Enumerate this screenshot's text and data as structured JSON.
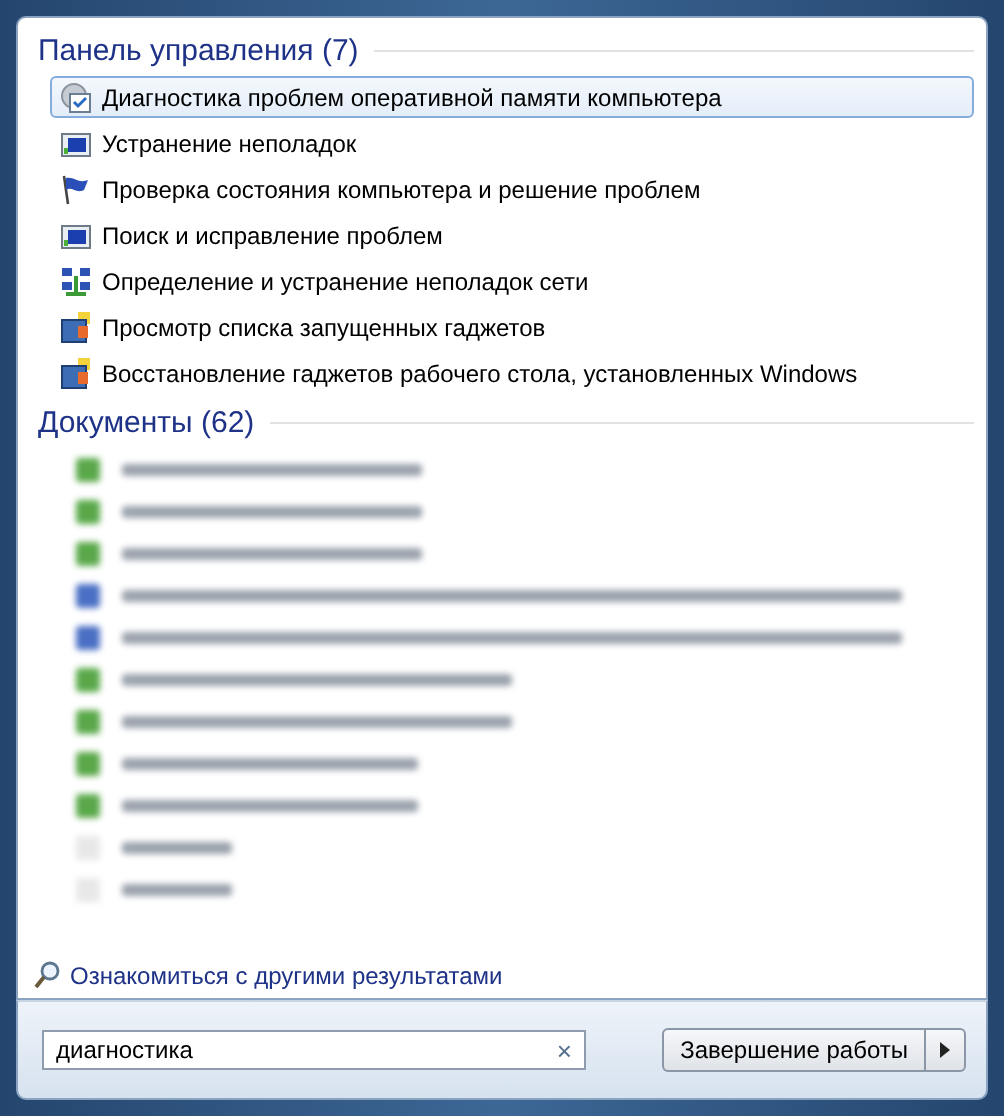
{
  "control_panel": {
    "heading": "Панель управления (7)",
    "items": [
      {
        "label": "Диагностика проблем оперативной памяти компьютера",
        "kind": "memory",
        "selected": true
      },
      {
        "label": "Устранение неполадок",
        "kind": "troubleshoot",
        "selected": false
      },
      {
        "label": "Проверка состояния компьютера и решение проблем",
        "kind": "flag",
        "selected": false
      },
      {
        "label": "Поиск и исправление проблем",
        "kind": "troubleshoot",
        "selected": false
      },
      {
        "label": "Определение и устранение неполадок сети",
        "kind": "network",
        "selected": false
      },
      {
        "label": "Просмотр списка запущенных гаджетов",
        "kind": "gadget",
        "selected": false
      },
      {
        "label": "Восстановление гаджетов рабочего стола, установленных Windows",
        "kind": "gadget",
        "selected": false
      }
    ]
  },
  "documents": {
    "heading": "Документы (62)",
    "items": [
      {
        "kind": "sheet"
      },
      {
        "kind": "sheet"
      },
      {
        "kind": "sheet"
      },
      {
        "kind": "doc"
      },
      {
        "kind": "doc"
      },
      {
        "kind": "sheet"
      },
      {
        "kind": "sheet"
      },
      {
        "kind": "sheet"
      },
      {
        "kind": "sheet"
      },
      {
        "kind": "blank"
      },
      {
        "kind": "blank"
      }
    ]
  },
  "more_results": "Ознакомиться с другими результатами",
  "search": {
    "value": "диагностика",
    "clear": "×"
  },
  "shutdown": {
    "label": "Завершение работы"
  }
}
